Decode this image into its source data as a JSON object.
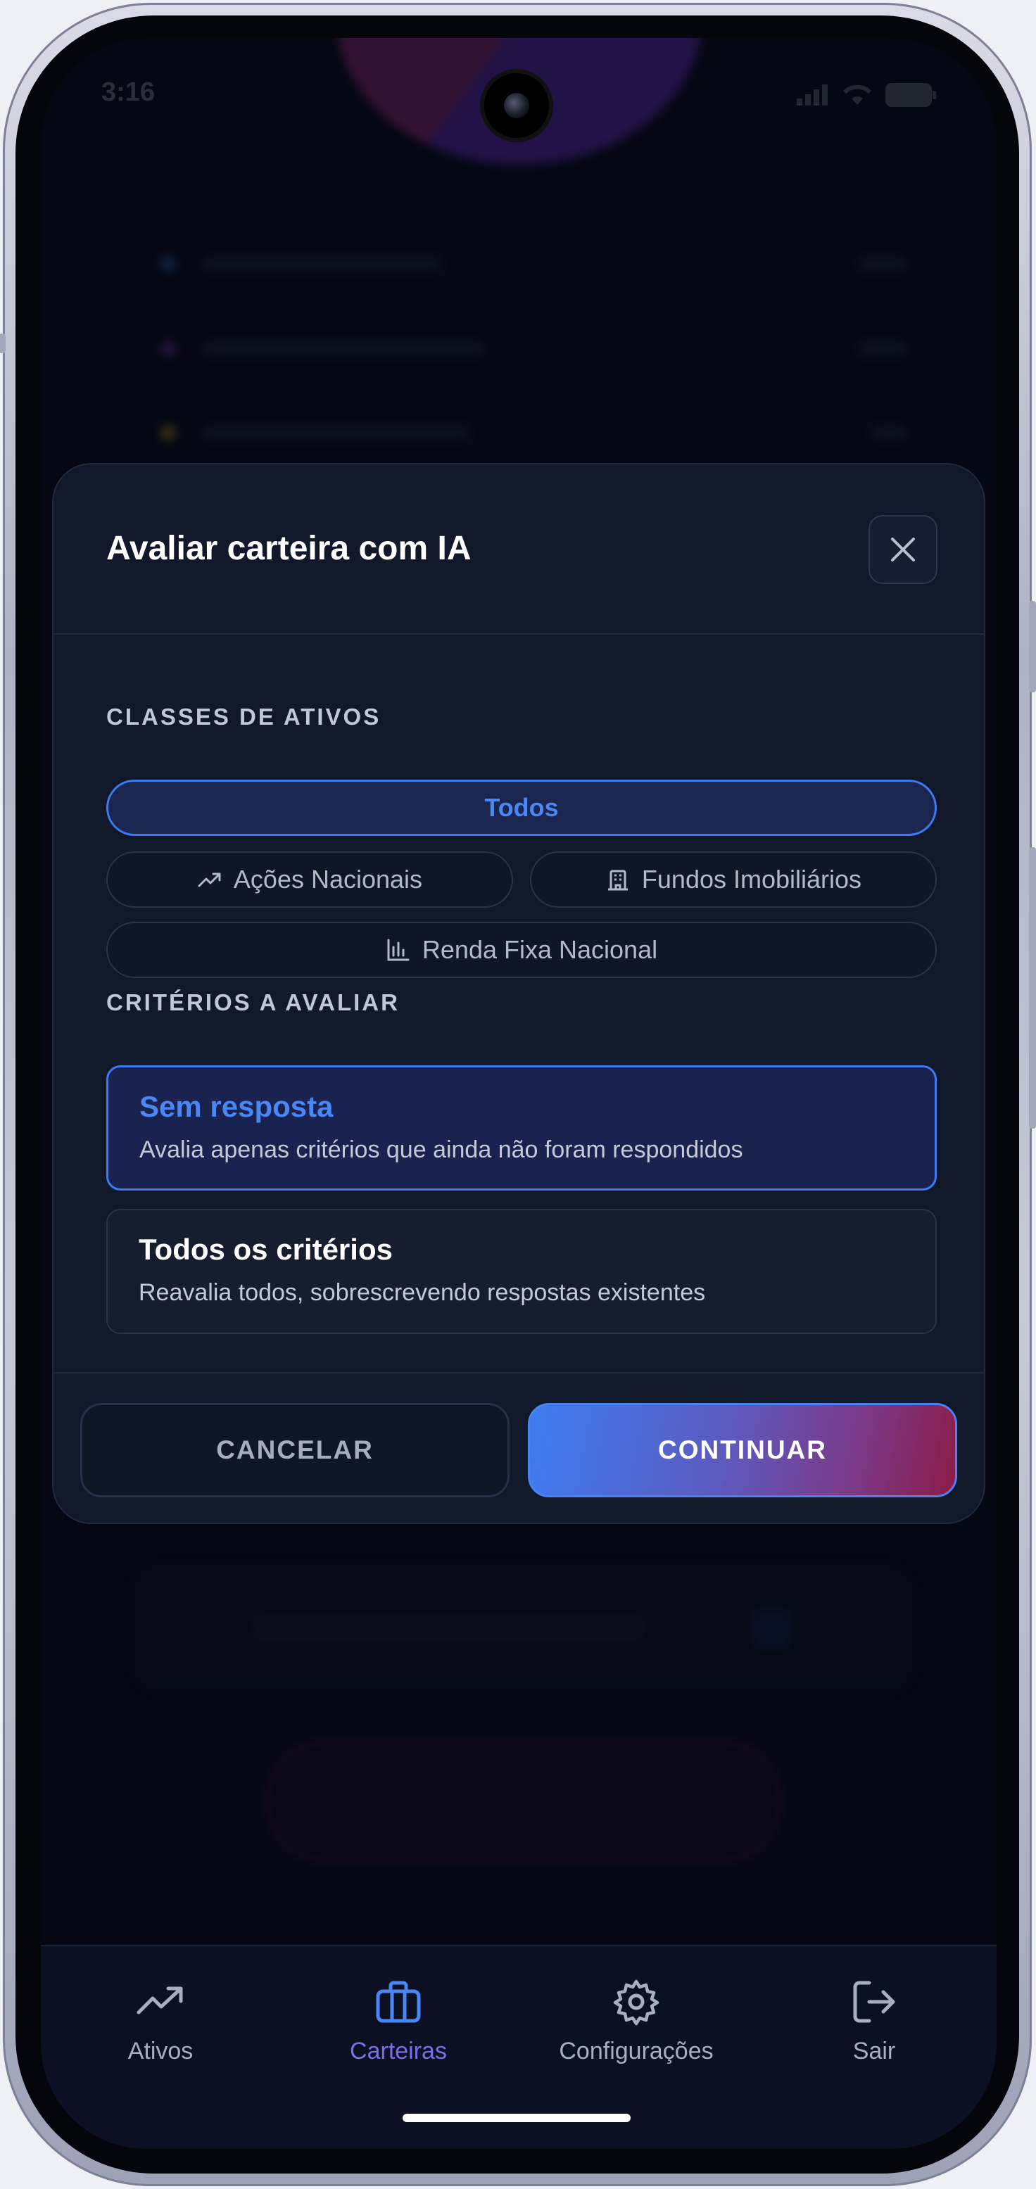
{
  "status_bar": {
    "time": "3:16"
  },
  "modal": {
    "title": "Avaliar carteira com IA",
    "asset_classes": {
      "label": "CLASSES DE ATIVOS",
      "chips": [
        {
          "label": "Todos",
          "selected": true
        },
        {
          "label": "Ações Nacionais",
          "icon": "trending-up-icon",
          "selected": false
        },
        {
          "label": "Fundos Imobiliários",
          "icon": "building-icon",
          "selected": false
        },
        {
          "label": "Renda Fixa Nacional",
          "icon": "bar-chart-icon",
          "selected": false
        }
      ]
    },
    "criteria": {
      "label": "CRITÉRIOS A AVALIAR",
      "options": [
        {
          "title": "Sem resposta",
          "description": "Avalia apenas critérios que ainda não foram respondidos",
          "selected": true
        },
        {
          "title": "Todos os critérios",
          "description": "Reavalia todos, sobrescrevendo respostas existentes",
          "selected": false
        }
      ]
    },
    "buttons": {
      "cancel": "CANCELAR",
      "continue": "CONTINUAR"
    }
  },
  "tabbar": {
    "items": [
      {
        "label": "Ativos",
        "icon": "trending-up-icon",
        "active": false
      },
      {
        "label": "Carteiras",
        "icon": "briefcase-icon",
        "active": true
      },
      {
        "label": "Configurações",
        "icon": "gear-icon",
        "active": false
      },
      {
        "label": "Sair",
        "icon": "logout-icon",
        "active": false
      }
    ]
  },
  "colors": {
    "accent": "#3e7bf2",
    "background": "#070b18",
    "modal": "#101829",
    "gradient_end": "#8c1c48"
  }
}
